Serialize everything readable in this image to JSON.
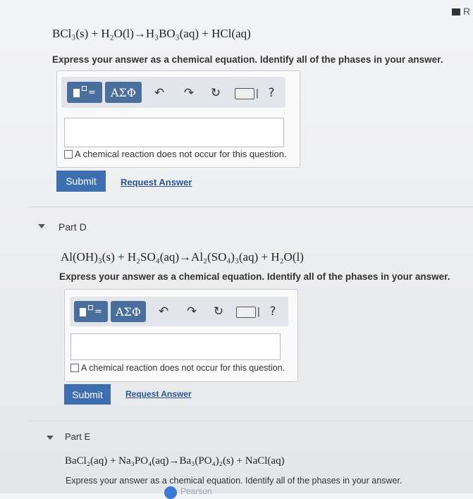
{
  "corner": {
    "text": "R"
  },
  "partC": {
    "equation": "BCl₃(s) + H₂O(l)→H₃BO₃(aq) + HCl(aq)",
    "prompt": "Express your answer as a chemical equation. Identify all of the phases in your answer.",
    "toolbar": {
      "greek": "ΑΣΦ",
      "help": "?"
    },
    "no_reaction": "A chemical reaction does not occur for this question.",
    "submit": "Submit",
    "request": "Request Answer"
  },
  "partD": {
    "label": "Part D",
    "equation": "Al(OH)₃(s) + H₂SO₄(aq)→Al₂(SO₄)₃(aq) + H₂O(l)",
    "prompt": "Express your answer as a chemical equation. Identify all of the phases in your answer.",
    "toolbar": {
      "greek": "ΑΣΦ",
      "help": "?"
    },
    "no_reaction": "A chemical reaction does not occur for this question.",
    "submit": "Submit",
    "request": "Request Answer"
  },
  "partE": {
    "label": "Part E",
    "equation": "BaCl₂(aq) + Na₃PO₄(aq)→Ba₃(PO₄)₂(s) + NaCl(aq)",
    "prompt": "Express your answer as a chemical equation. Identify all of the phases in your answer."
  },
  "footer": {
    "brand": "Pearson"
  }
}
